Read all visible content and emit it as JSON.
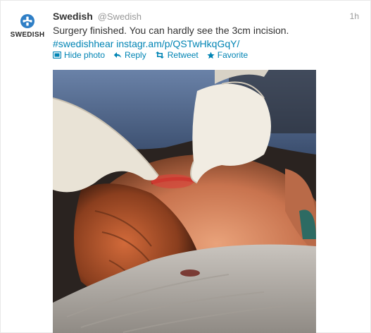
{
  "tweet": {
    "avatar_wordmark": "SWEDISH",
    "fullname": "Swedish",
    "handle": "@Swedish",
    "time": "1h",
    "text": "Surgery finished. You can hardly see the 3cm incision.",
    "hashtag": "#swedishhear",
    "link": "instagr.am/p/QSTwHkqGqY/",
    "actions": {
      "hide_photo": "Hide photo",
      "reply": "Reply",
      "retweet": "Retweet",
      "favorite": "Favorite"
    },
    "icons": {
      "hide_photo": "photo-icon",
      "reply": "reply-arrow-icon",
      "retweet": "retweet-icon",
      "favorite": "star-icon"
    }
  },
  "colors": {
    "link": "#0084b4",
    "brand_blue": "#2f7fc6",
    "muted": "#999999"
  }
}
